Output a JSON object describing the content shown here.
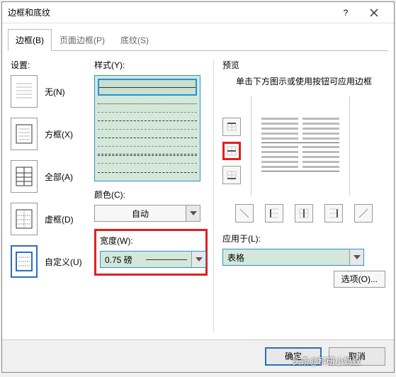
{
  "title": "边框和底纹",
  "tabs": {
    "border": "边框(B)",
    "page_border": "页面边框(P)",
    "shading": "底纹(S)"
  },
  "settings": {
    "label": "设置:",
    "none": "无(N)",
    "box": "方框(X)",
    "all": "全部(A)",
    "grid": "虚框(D)",
    "custom": "自定义(U)"
  },
  "style": {
    "label": "样式(Y):"
  },
  "color": {
    "label": "颜色(C):",
    "value": "自动"
  },
  "width": {
    "label": "宽度(W):",
    "value": "0.75 磅"
  },
  "preview": {
    "label": "预览",
    "hint": "单击下方图示或使用按钮可应用边框"
  },
  "apply": {
    "label": "应用于(L):",
    "value": "表格"
  },
  "options_btn": "选项(O)...",
  "ok": "确定",
  "cancel": "取消",
  "watermark": "头条@科研小蚂蚁"
}
